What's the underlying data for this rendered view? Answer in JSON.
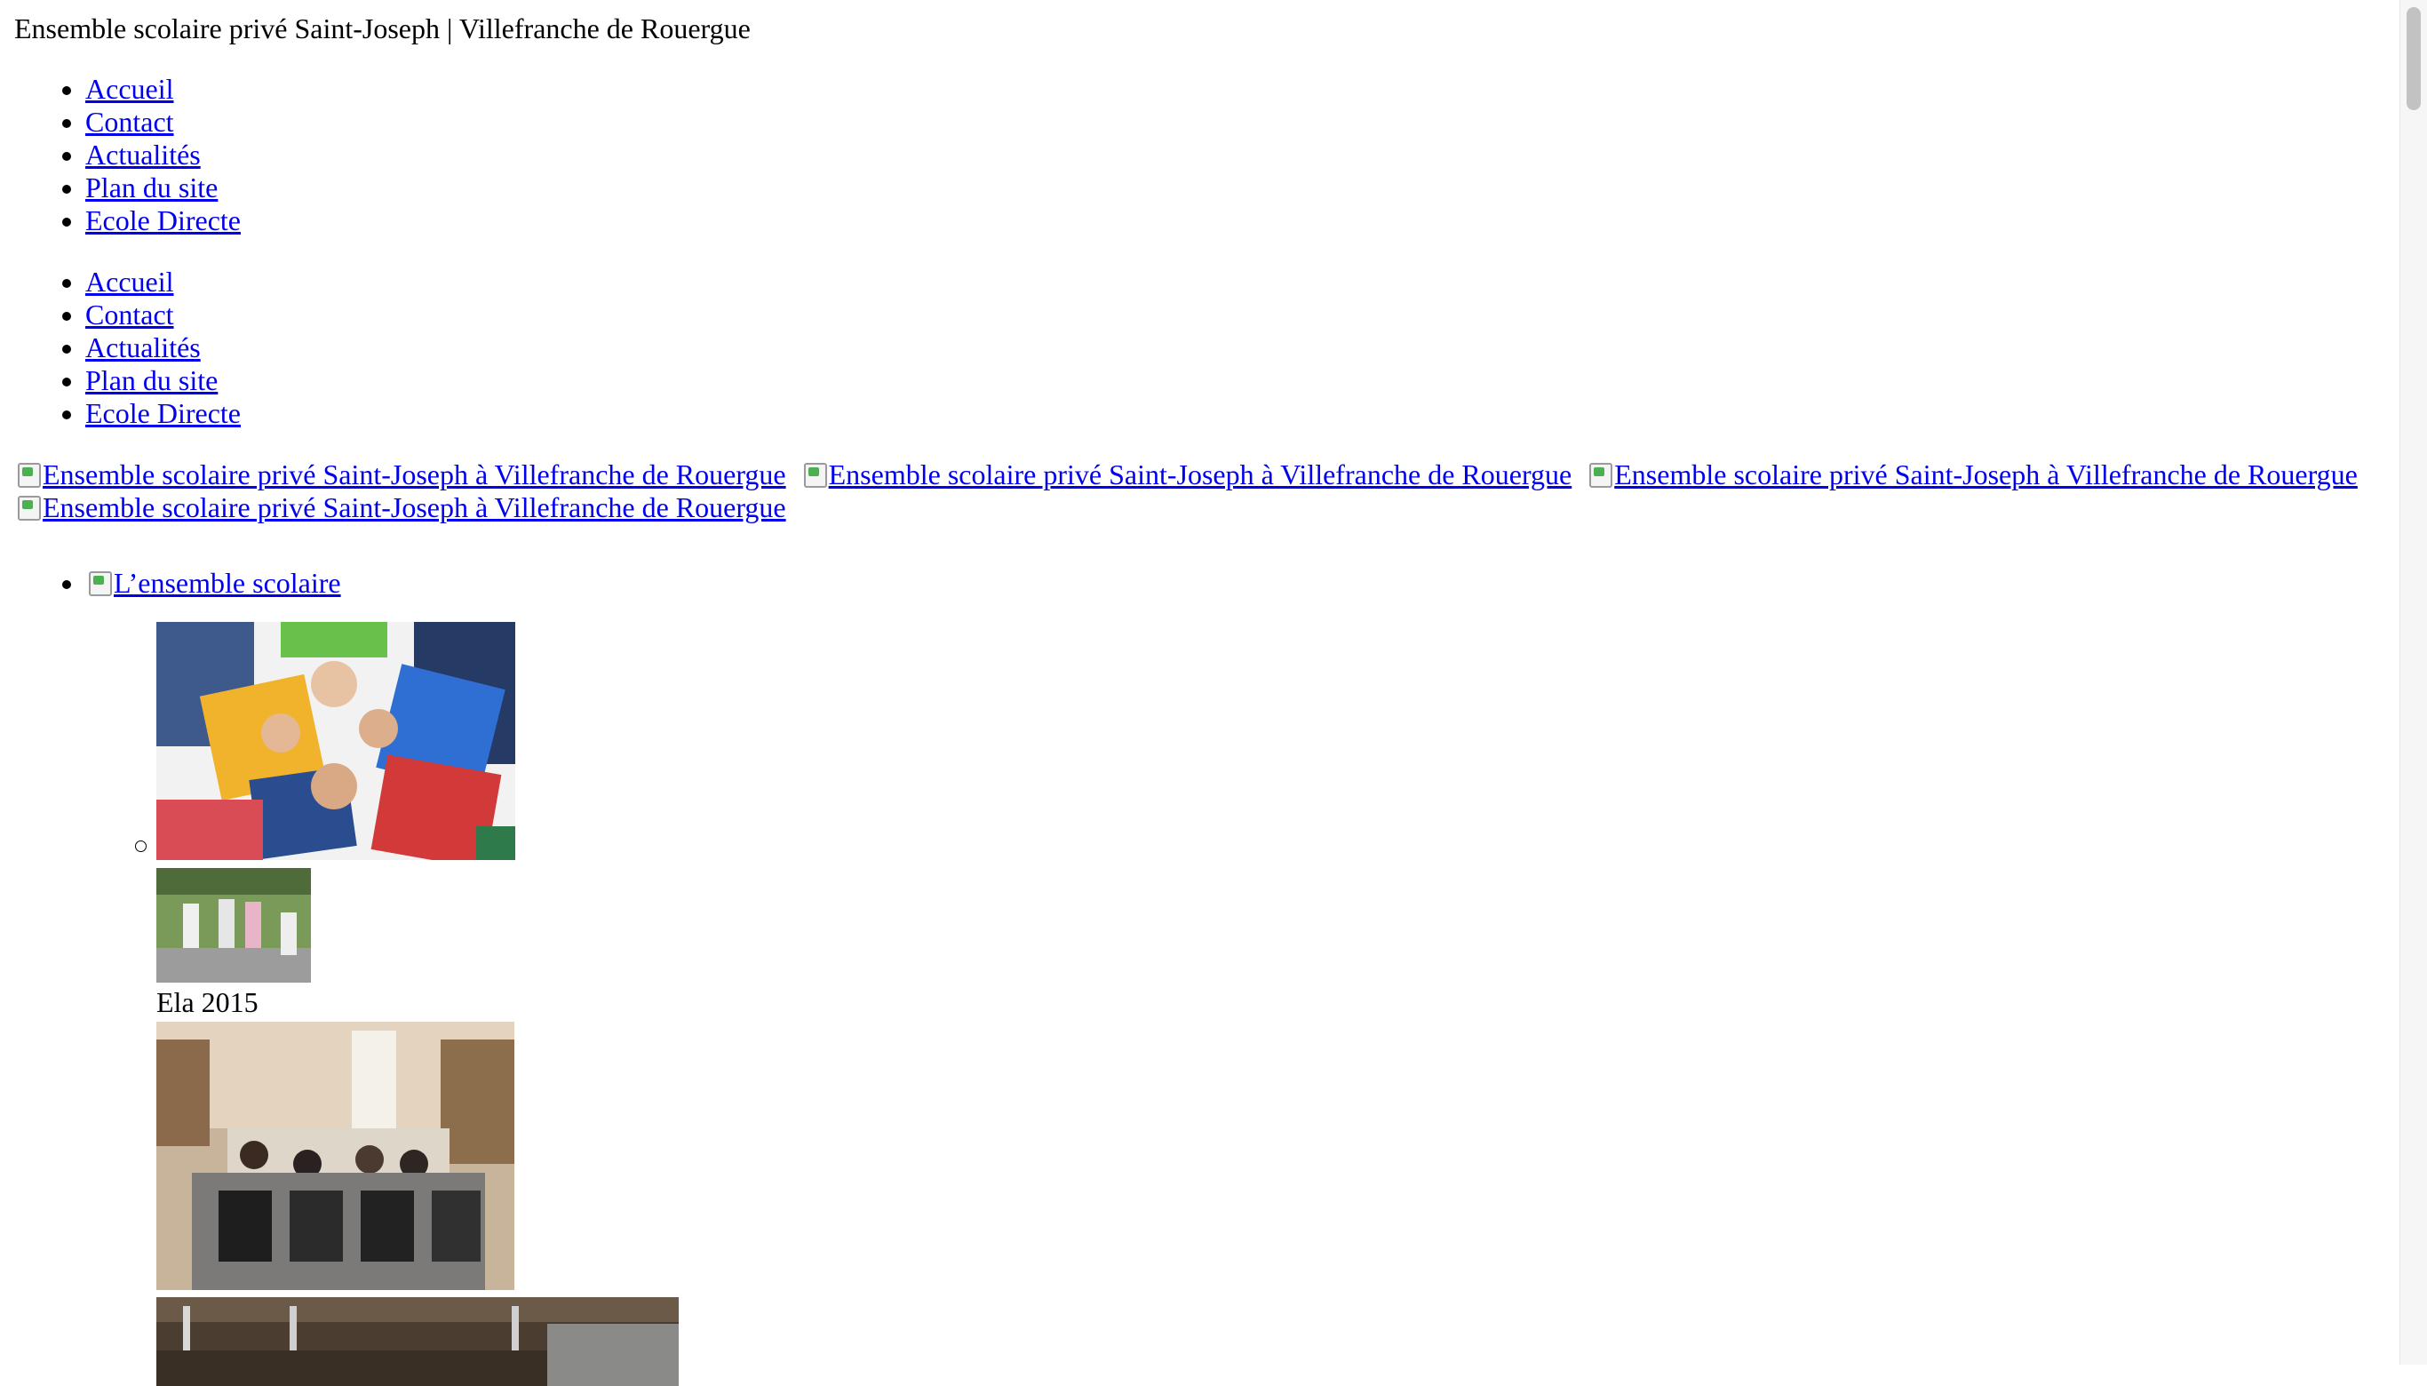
{
  "site": {
    "title": "Ensemble scolaire privé Saint-Joseph | Villefranche de Rouergue"
  },
  "menu1": [
    "Accueil",
    "Contact",
    "Actualités",
    "Plan du site",
    "Ecole Directe"
  ],
  "menu2": [
    "Accueil",
    "Contact",
    "Actualités",
    "Plan du site",
    "Ecole Directe"
  ],
  "banner": {
    "alt": "Ensemble scolaire privé Saint-Joseph à Villefranche de Rouergue"
  },
  "section": {
    "label": "L’ensemble scolaire"
  },
  "gallery": {
    "caption": "Ela 2015"
  }
}
